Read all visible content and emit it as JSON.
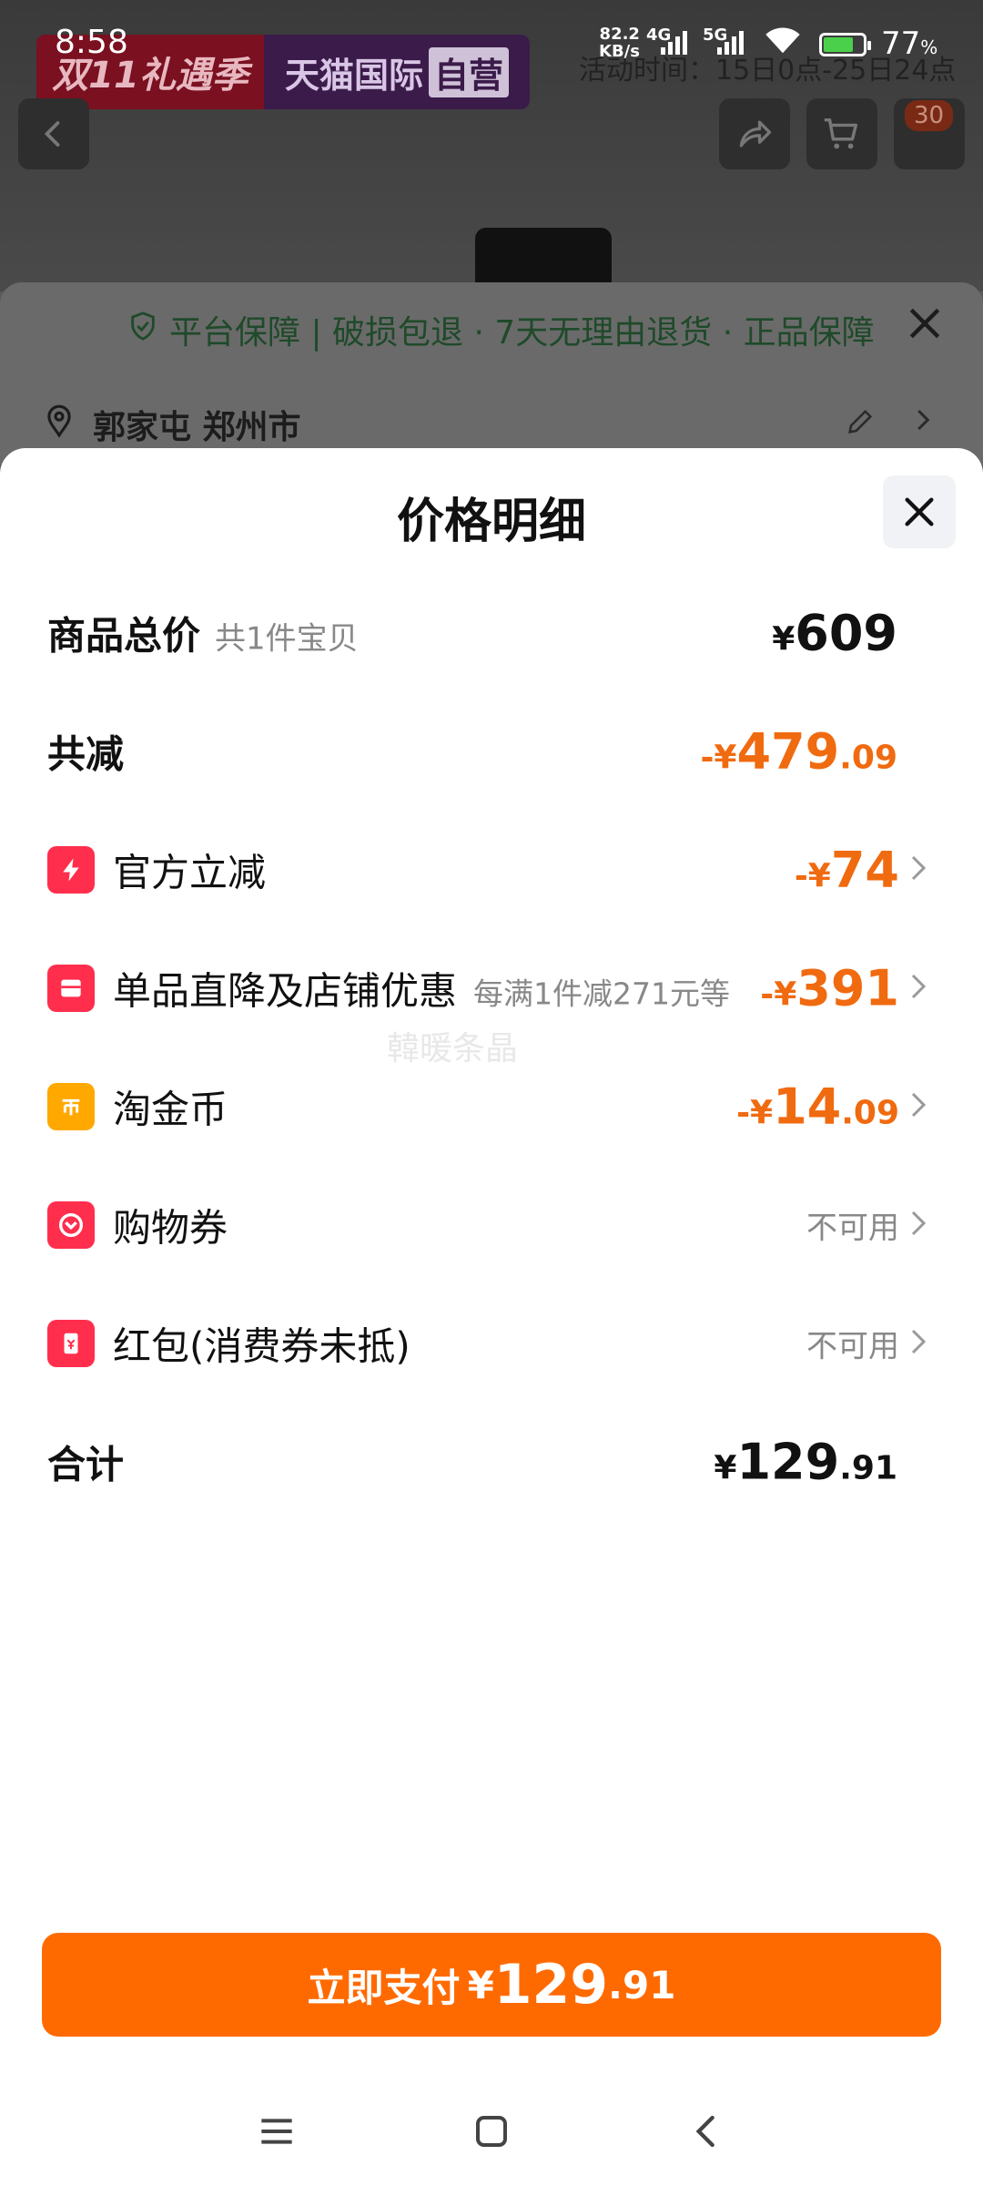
{
  "status_bar": {
    "time": "8:58",
    "net_speed_value": "82.2",
    "net_speed_unit": "KB/s",
    "net_type_1": "4G",
    "net_type_2": "5G",
    "battery_percent": "77",
    "battery_percent_sign": "%"
  },
  "background": {
    "banner_left": "双11礼遇季",
    "banner_right": "天猫国际",
    "banner_tag": "自营",
    "activity_time": "活动时间：15日0点-25日24点",
    "cart_badge": "30",
    "guarantee": "平台保障 | 破损包退 · 7天无理由退货 · 正品保障",
    "address": "郭家屯 郑州市"
  },
  "sheet": {
    "title": "价格明细",
    "rows": {
      "goods_total": {
        "label": "商品总价",
        "sub": "共1件宝贝",
        "currency": "¥",
        "int": "609",
        "dec": ""
      },
      "total_discount": {
        "label": "共减",
        "currency": "-¥",
        "int": "479",
        "dec": ".09"
      },
      "official": {
        "label": "官方立减",
        "currency": "-¥",
        "int": "74",
        "dec": ""
      },
      "store": {
        "label": "单品直降及店铺优惠",
        "sub": "每满1件减271元等",
        "currency": "-¥",
        "int": "391",
        "dec": ""
      },
      "coins": {
        "label": "淘金币",
        "currency": "-¥",
        "int": "14",
        "dec": ".09"
      },
      "voucher": {
        "label": "购物券",
        "status": "不可用"
      },
      "red_packet": {
        "label": "红包(消费券未抵)",
        "status": "不可用"
      },
      "sum": {
        "label": "合计",
        "currency": "¥",
        "int": "129",
        "dec": ".91"
      }
    },
    "watermark": "韓暖条晶"
  },
  "pay_button": {
    "label": "立即支付",
    "currency": "¥",
    "int": "129",
    "dec": ".91"
  },
  "colors": {
    "accent_orange": "#ff6a00",
    "discount_orange": "#f06a10",
    "red_icon": "#ff2e4d",
    "coin_icon": "#ffa800",
    "guarantee_green": "#1f4a2a"
  },
  "icons": {
    "official": "lightning-icon",
    "store": "shop-icon",
    "coins": "coin-icon",
    "voucher": "voucher-icon",
    "red_packet": "red-packet-icon"
  }
}
